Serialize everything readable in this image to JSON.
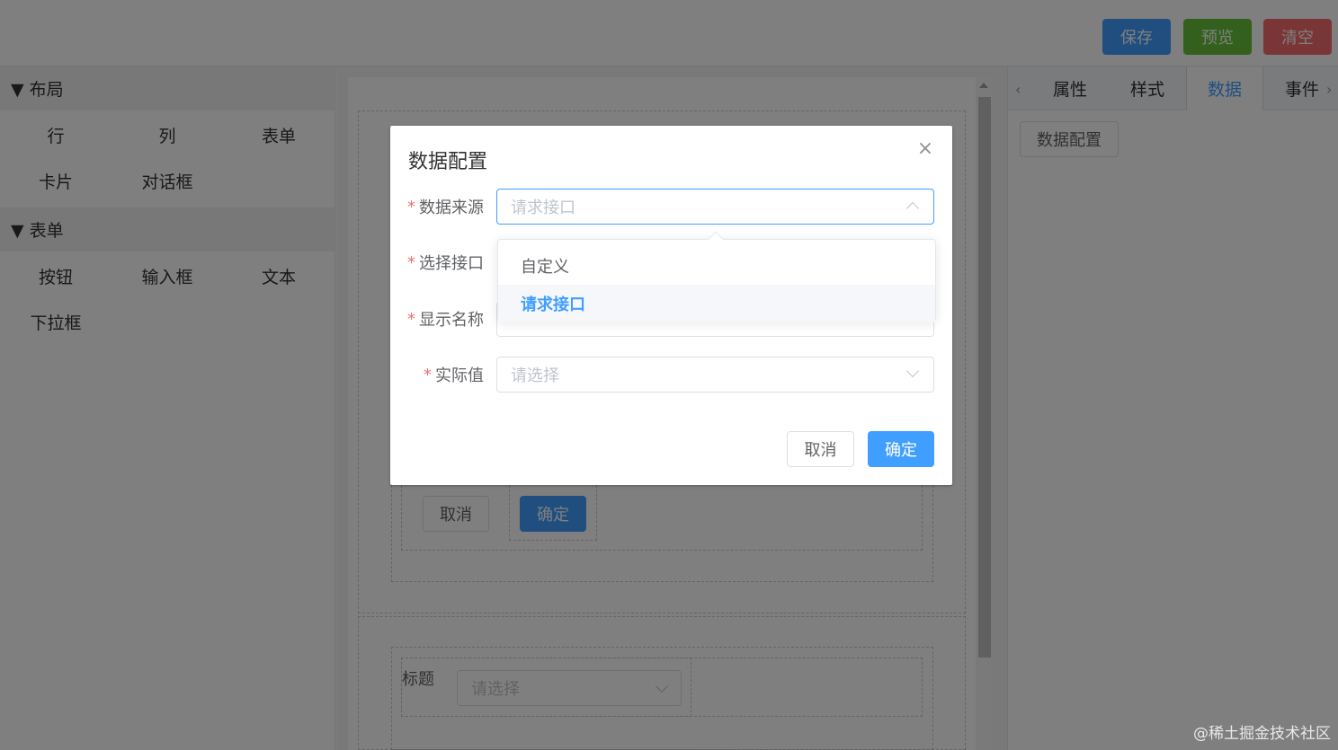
{
  "toolbar": {
    "save_label": "保存",
    "preview_label": "预览",
    "clear_label": "清空",
    "colors": {
      "save": "#409eff",
      "preview": "#67c23a",
      "clear": "#f56c6c"
    }
  },
  "sidebar": {
    "groups": [
      {
        "title": "▼ 布局",
        "items": [
          "行",
          "列",
          "表单",
          "卡片",
          "对话框"
        ]
      },
      {
        "title": "▼ 表单",
        "items": [
          "按钮",
          "输入框",
          "文本",
          "下拉框"
        ]
      }
    ]
  },
  "canvas": {
    "cancel_label": "取消",
    "ok_label": "确定",
    "title_label": "标题",
    "select_placeholder": "请选择"
  },
  "right_panel": {
    "tabs": [
      "属性",
      "样式",
      "数据",
      "事件"
    ],
    "active_tab": "数据",
    "data_config_button": "数据配置"
  },
  "dialog": {
    "title": "数据配置",
    "close_icon": "close-icon",
    "fields": {
      "source": {
        "label": "数据来源",
        "value": "请求接口"
      },
      "api": {
        "label": "选择接口"
      },
      "display": {
        "label": "显示名称"
      },
      "actual": {
        "label": "实际值",
        "placeholder": "请选择"
      }
    },
    "dropdown_options": [
      "自定义",
      "请求接口"
    ],
    "selected_option": "请求接口",
    "cancel_label": "取消",
    "ok_label": "确定",
    "accent": "#409eff",
    "required_mark": "*"
  },
  "watermark": "@稀土掘金技术社区"
}
